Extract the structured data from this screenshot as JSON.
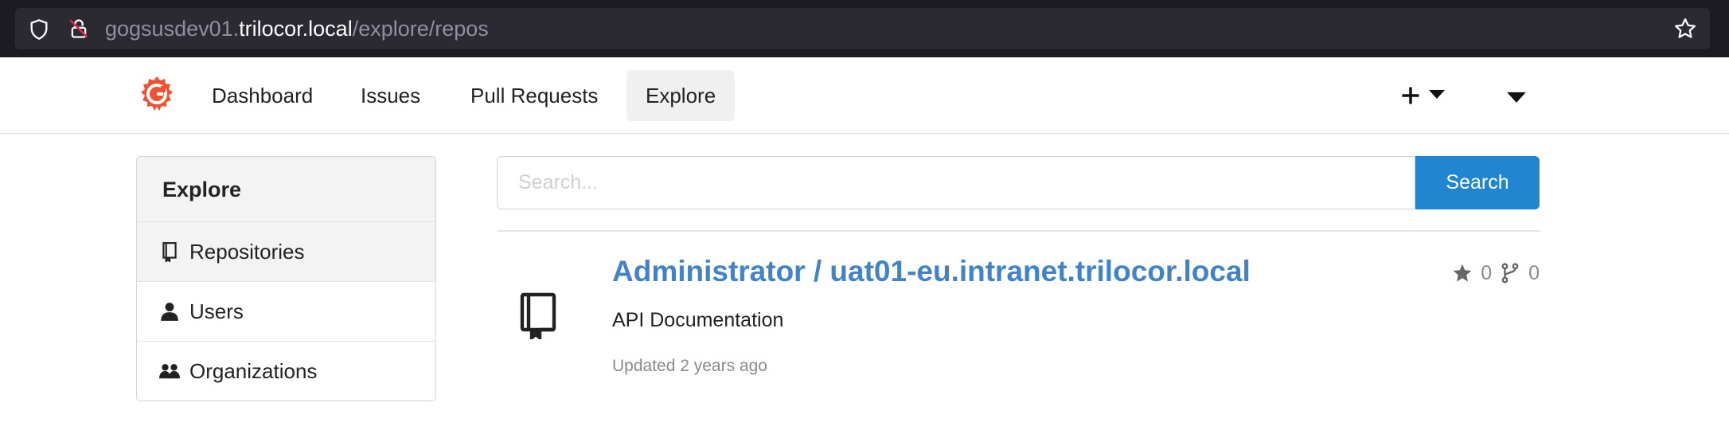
{
  "browser": {
    "url_prefix": "gogsusdev01.",
    "url_host": "trilocor.local",
    "url_path": "/explore/repos"
  },
  "nav": {
    "items": [
      {
        "label": "Dashboard"
      },
      {
        "label": "Issues"
      },
      {
        "label": "Pull Requests"
      },
      {
        "label": "Explore",
        "active": true
      }
    ]
  },
  "sidebar": {
    "title": "Explore",
    "items": [
      {
        "label": "Repositories",
        "icon": "repo-icon",
        "active": true
      },
      {
        "label": "Users",
        "icon": "person-icon"
      },
      {
        "label": "Organizations",
        "icon": "organization-icon"
      }
    ]
  },
  "search": {
    "placeholder": "Search...",
    "button_label": "Search"
  },
  "repos": [
    {
      "title": "Administrator / uat01-eu.intranet.trilocor.local",
      "description": "API Documentation",
      "updated": "Updated 2 years ago",
      "stars": "0",
      "forks": "0"
    }
  ],
  "colors": {
    "accent": "#2185d0",
    "link": "#4183c4",
    "logo": "#f05133"
  }
}
